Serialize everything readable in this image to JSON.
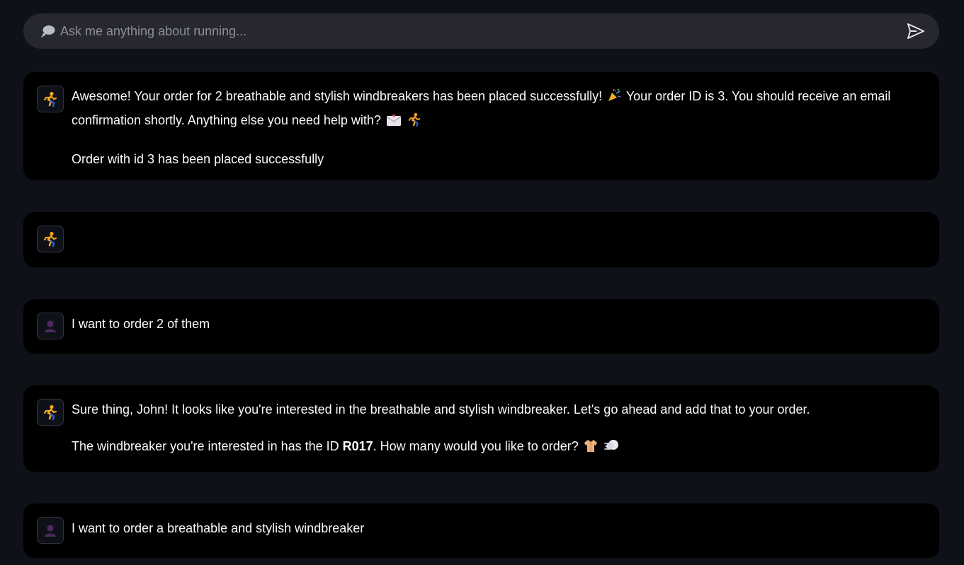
{
  "input": {
    "placeholder": "Ask me anything about running...",
    "value": "",
    "leading_icon": "speech-bubble-icon",
    "send_icon": "send-icon"
  },
  "colors": {
    "page_bg": "#0e1117",
    "bubble_bg": "#000000",
    "input_bg": "#262730",
    "text": "#fafafa",
    "placeholder": "#8e8f96",
    "user_avatar": "#4b2a63",
    "assistant_avatar": "#f5a623"
  },
  "messages": [
    {
      "role": "assistant",
      "avatar_icon": "runner-icon",
      "line1_part1": "Awesome! Your order for 2 breathable and stylish windbreakers has been placed successfully!",
      "line1_emoji": "party-popper-icon",
      "line1_part2": "Your order ID is 3. You should receive an email confirmation shortly. Anything else you need help with?",
      "line1_trailing_emojis": [
        "envelope-icon",
        "runner-icon"
      ],
      "line2": "Order with id 3 has been placed successfully"
    },
    {
      "role": "assistant",
      "avatar_icon": "runner-icon",
      "text": ""
    },
    {
      "role": "user",
      "avatar_icon": "user-silhouette-icon",
      "text": "I want to order 2 of them"
    },
    {
      "role": "assistant",
      "avatar_icon": "runner-icon",
      "line1": "Sure thing, John! It looks like you're interested in the breathable and stylish windbreaker. Let's go ahead and add that to your order.",
      "line2_part1": "The windbreaker you're interested in has the ID ",
      "line2_bold": "R017",
      "line2_part2": ". How many would you like to order?",
      "line2_trailing_emojis": [
        "coat-icon",
        "wind-icon"
      ]
    },
    {
      "role": "user",
      "avatar_icon": "user-silhouette-icon",
      "text": "I want to order a breathable and stylish windbreaker"
    }
  ]
}
